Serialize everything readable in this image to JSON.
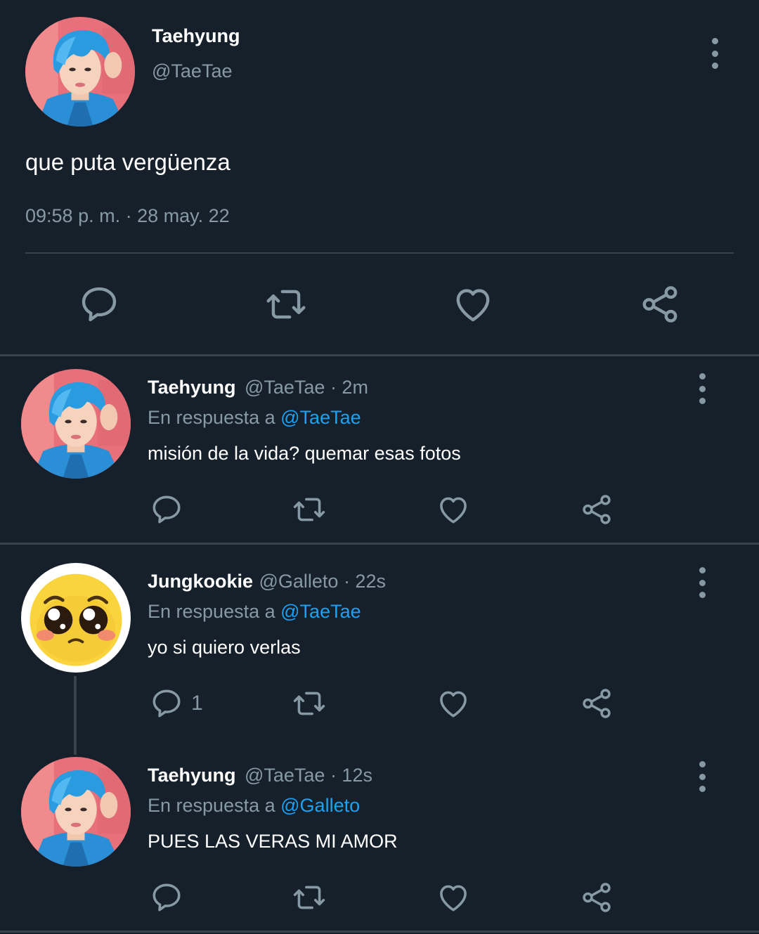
{
  "main_tweet": {
    "display_name": "Taehyung",
    "handle": "@TaeTae",
    "text": "que puta vergüenza",
    "timestamp": "09:58 p. m. · 28 may. 22",
    "actions": [
      "reply-icon",
      "retweet-icon",
      "like-icon",
      "share-icon"
    ]
  },
  "replies": [
    {
      "display_name": "Taehyung",
      "handle_time": "@TaeTae · 2m",
      "reply_prefix": "En respuesta a",
      "reply_to": "@TaeTae",
      "text": "misión de la vida? quemar esas fotos",
      "reply_count": ""
    },
    {
      "display_name": "Jungkookie",
      "handle_time": "@Galleto · 22s",
      "reply_prefix": "En respuesta a",
      "reply_to": "@TaeTae",
      "text": "yo si quiero verlas",
      "reply_count": "1"
    },
    {
      "display_name": "Taehyung",
      "handle_time": "@TaeTae · 12s",
      "reply_prefix": "En respuesta a",
      "reply_to": "@Galleto",
      "text": "PUES LAS VERAS MI AMOR",
      "reply_count": ""
    }
  ],
  "colors": {
    "background": "#15202b",
    "secondary_text": "#8899a6",
    "mention": "#1da1f2",
    "divider": "#38444d"
  }
}
